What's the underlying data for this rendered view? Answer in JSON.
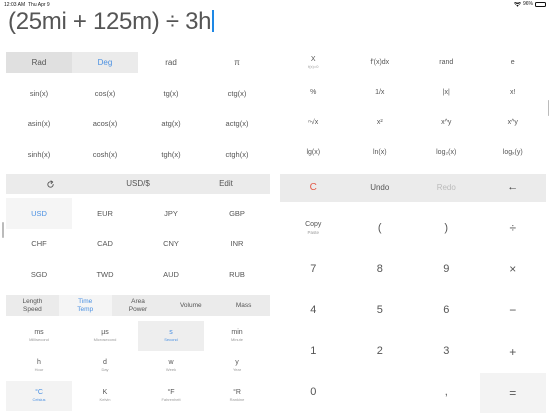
{
  "status": {
    "time": "12:03 AM",
    "date": "Thu Apr 9",
    "battery": "96%",
    "battery_level": 0.96,
    "wifi_icon": "wifi-icon",
    "battery_icon": "battery-icon"
  },
  "expression": "(25mi + 125m) ÷ 3h",
  "angle_modes": [
    "Rad",
    "Deg",
    "rad",
    "π"
  ],
  "functions": [
    [
      "sin(x)",
      "cos(x)",
      "tg(x)",
      "ctg(x)"
    ],
    [
      "asin(x)",
      "acos(x)",
      "atg(x)",
      "actg(x)"
    ],
    [
      "sinh(x)",
      "cosh(x)",
      "tgh(x)",
      "ctgh(x)"
    ]
  ],
  "currency_bar": {
    "refresh_icon": "refresh-icon",
    "pair": "USD/$",
    "edit": "Edit"
  },
  "currencies": [
    [
      "USD",
      "EUR",
      "JPY",
      "GBP"
    ],
    [
      "CHF",
      "CAD",
      "CNY",
      "INR"
    ],
    [
      "SGD",
      "TWD",
      "AUD",
      "RUB"
    ]
  ],
  "unit_tabs": [
    {
      "line1": "Length",
      "line2": "Speed"
    },
    {
      "line1": "Time",
      "line2": "Temp"
    },
    {
      "line1": "Area",
      "line2": "Power"
    },
    {
      "line1": "Volume",
      "line2": ""
    },
    {
      "line1": "Mass",
      "line2": ""
    }
  ],
  "units": [
    [
      {
        "label": "ms",
        "sub": "Millisecond"
      },
      {
        "label": "µs",
        "sub": "Microsecond"
      },
      {
        "label": "s",
        "sub": "Second"
      },
      {
        "label": "min",
        "sub": "Minute"
      }
    ],
    [
      {
        "label": "h",
        "sub": "Hour"
      },
      {
        "label": "d",
        "sub": "Day"
      },
      {
        "label": "w",
        "sub": "Week"
      },
      {
        "label": "y",
        "sub": "Year"
      }
    ],
    [
      {
        "label": "°C",
        "sub": "Celsius"
      },
      {
        "label": "K",
        "sub": "Kelvin"
      },
      {
        "label": "°F",
        "sub": "Fahrenheit"
      },
      {
        "label": "°R",
        "sub": "Rankine"
      }
    ]
  ],
  "right_functions": [
    [
      {
        "label": "X",
        "sub": "f(x)=0"
      },
      {
        "label": "f'(x)dx",
        "sub": ""
      },
      {
        "label": "rand",
        "sub": ""
      },
      {
        "label": "e",
        "sub": ""
      }
    ],
    [
      {
        "label": "%",
        "sub": ""
      },
      {
        "label": "1/x",
        "sub": ""
      },
      {
        "label": "|x|",
        "sub": ""
      },
      {
        "label": "x!",
        "sub": ""
      }
    ],
    [
      {
        "label": "ⁿ√x",
        "sub": ""
      },
      {
        "label": "x²",
        "sub": ""
      },
      {
        "label": "x^y",
        "sub": ""
      },
      {
        "label": "x^y",
        "sub": ""
      }
    ],
    [
      {
        "label": "lg(x)",
        "sub": ""
      },
      {
        "label": "ln(x)",
        "sub": ""
      },
      {
        "label": "log₂(x)",
        "sub": ""
      },
      {
        "label": "logₓ(y)",
        "sub": ""
      }
    ]
  ],
  "edit_row": {
    "clear": "C",
    "undo": "Undo",
    "redo": "Redo",
    "backspace": "←"
  },
  "keypad": {
    "copy": "Copy",
    "paste": "Paste",
    "open_paren": "(",
    "close_paren": ")",
    "divide": "÷",
    "rows": [
      [
        "7",
        "8",
        "9",
        "×"
      ],
      [
        "4",
        "5",
        "6",
        "−"
      ],
      [
        "1",
        "2",
        "3",
        "+"
      ]
    ],
    "zero": "0",
    "dot": ",",
    "equals": "="
  },
  "colors": {
    "accent": "#4a90e2",
    "clear": "#e35b4a",
    "bar": "#ebebeb"
  }
}
